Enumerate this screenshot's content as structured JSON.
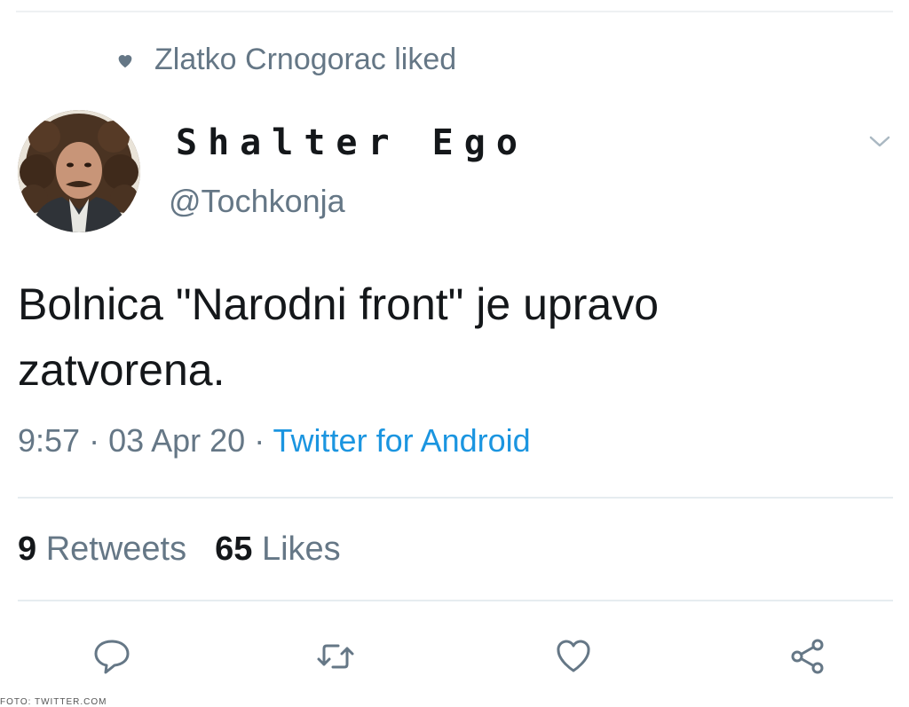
{
  "social_context": {
    "icon": "heart-icon",
    "text": "Zlatko Crnogorac liked"
  },
  "author": {
    "display_name": "Shalter Ego",
    "handle": "@Tochkonja"
  },
  "tweet": {
    "text": "Bolnica \"Narodni front\" je upravo zatvorena.",
    "time": "9:57",
    "separator": " · ",
    "date": "03 Apr 20",
    "source": "Twitter for Android"
  },
  "stats": {
    "retweets_count": "9",
    "retweets_label": "Retweets",
    "likes_count": "65",
    "likes_label": "Likes"
  },
  "actions": {
    "reply_icon": "reply-icon",
    "retweet_icon": "retweet-icon",
    "like_icon": "like-heart-icon",
    "share_icon": "share-icon"
  },
  "footer": {
    "credit": "FOTO: TWITTER.COM"
  },
  "colors": {
    "secondary_text": "#657786",
    "link": "#1b95e0",
    "primary_text": "#14171a",
    "divider": "#e6ecf0"
  }
}
